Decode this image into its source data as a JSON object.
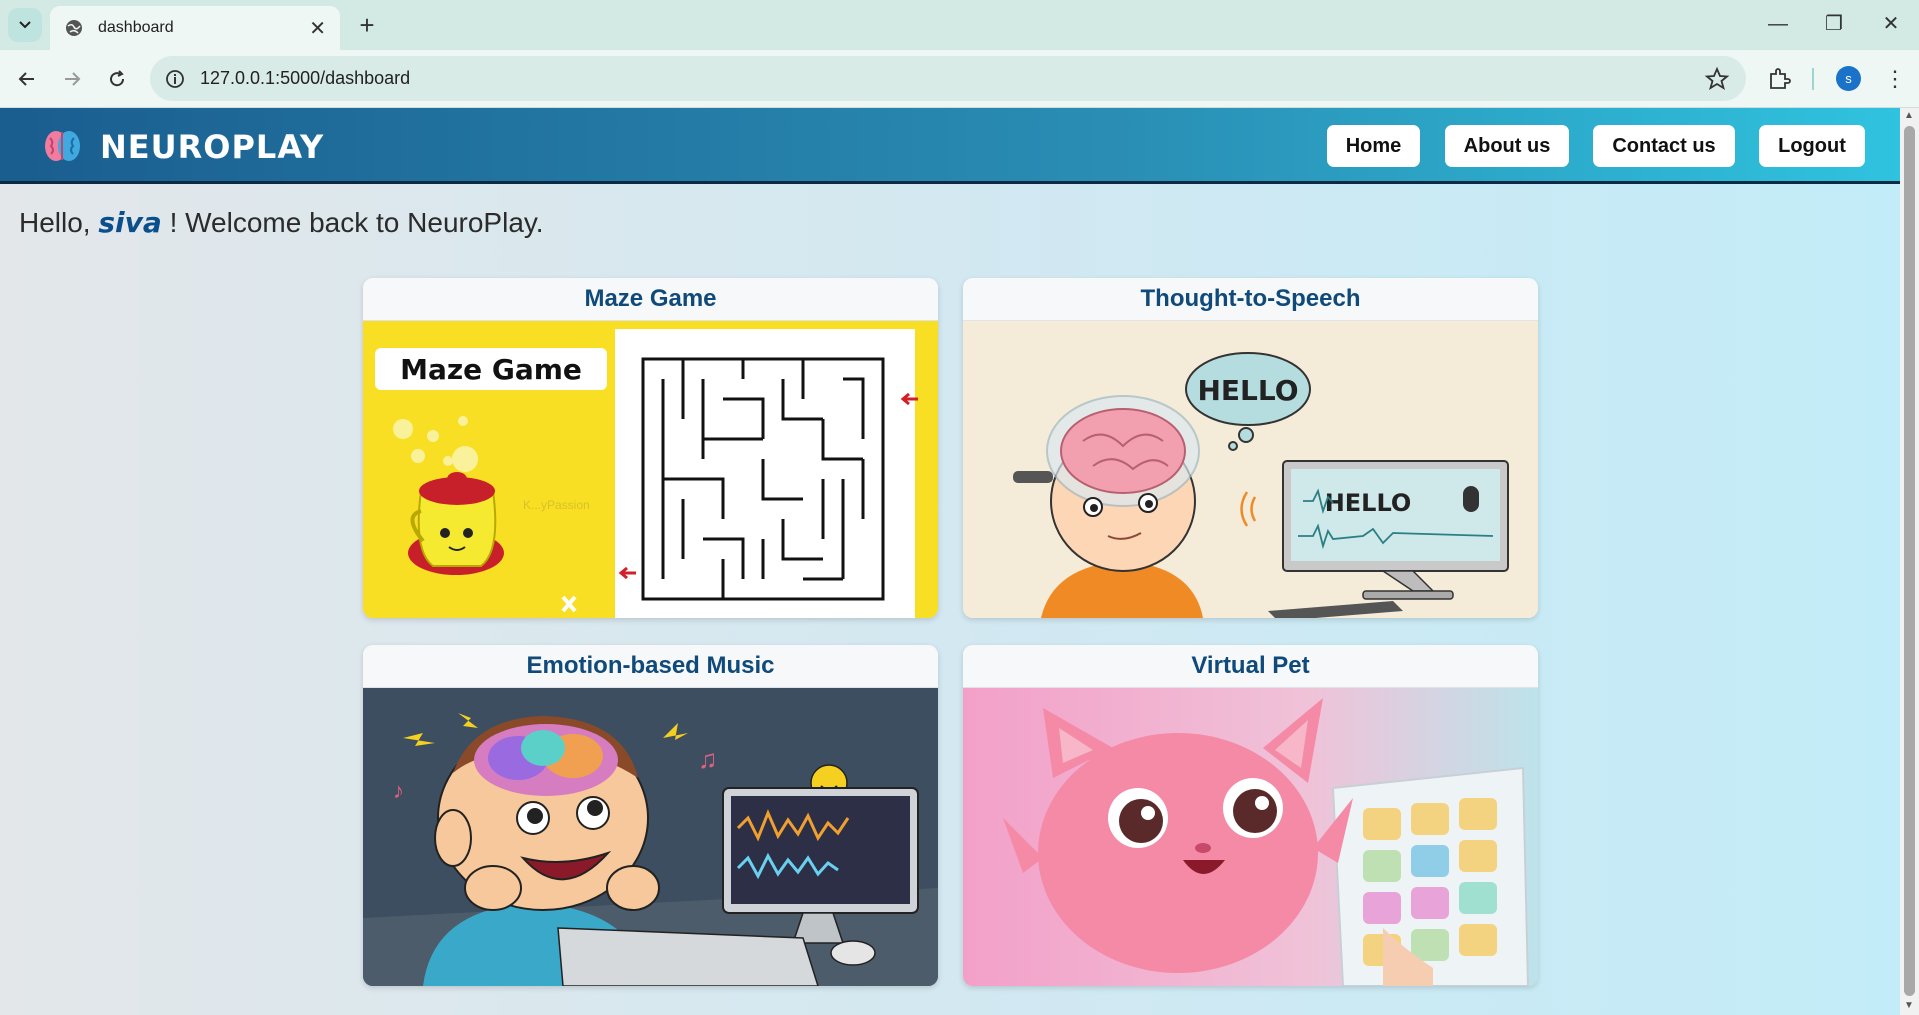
{
  "browser": {
    "tab_title": "dashboard",
    "url": "127.0.0.1:5000/dashboard",
    "profile_initial": "s"
  },
  "header": {
    "brand": "NEUROPLAY",
    "nav": {
      "home": "Home",
      "about": "About us",
      "contact": "Contact us",
      "logout": "Logout"
    }
  },
  "greeting": {
    "prefix": "Hello,",
    "username": "siva",
    "suffix": "! Welcome back to NeuroPlay."
  },
  "games": {
    "maze": {
      "title": "Maze Game",
      "banner": "Maze Game",
      "watermark": "K...yPassion"
    },
    "speech": {
      "title": "Thought-to-Speech",
      "bubble": "HELLO",
      "screen": "HELLO"
    },
    "music": {
      "title": "Emotion-based Music"
    },
    "pet": {
      "title": "Virtual Pet"
    }
  },
  "colors": {
    "brand_dark": "#1a5d8f",
    "brand_light": "#2fc3df",
    "card_title": "#0f4a7a"
  }
}
